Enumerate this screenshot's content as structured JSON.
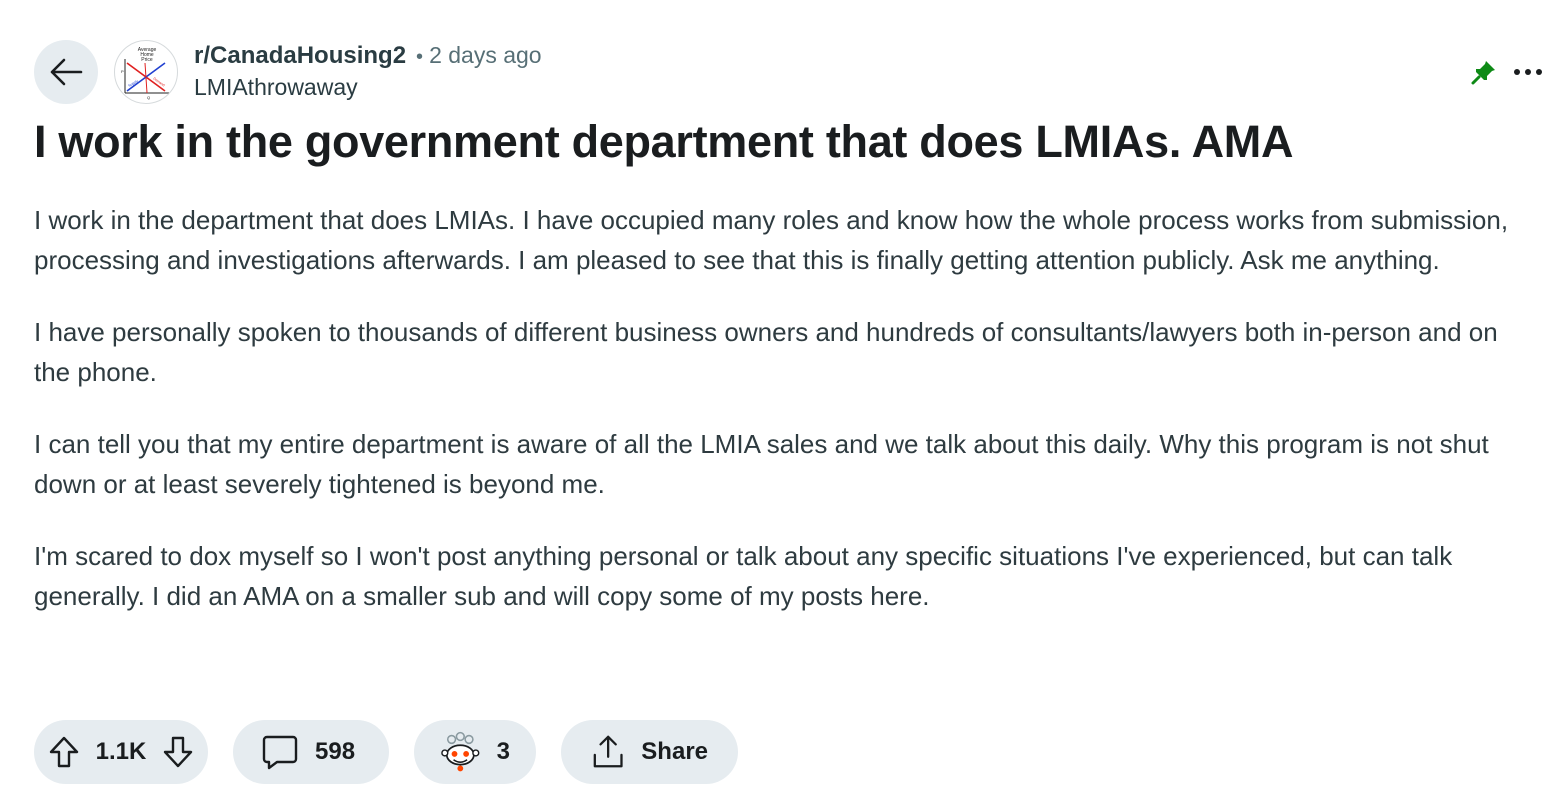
{
  "header": {
    "subreddit": "r/CanadaHousing2",
    "separator": "•",
    "time": "2 days ago",
    "author": "LMIAthrowaway",
    "avatar_labels": {
      "top": "Average",
      "top2": "Home",
      "top3": "Price",
      "p": "P",
      "q": "Q",
      "supply": "Supply",
      "demand": "Demand"
    }
  },
  "post": {
    "title": "I work in the government department that does LMIAs. AMA",
    "paragraphs": [
      "I work in the department that does LMIAs. I have occupied many roles and know how the whole process works from submission, processing and investigations afterwards. I am pleased to see that this is finally getting attention publicly. Ask me anything.",
      "I have personally spoken to thousands of different business owners and hundreds of consultants/lawyers both in-person and on the phone.",
      "I can tell you that my entire department is aware of all the LMIA sales and we talk about this daily. Why this program is not shut down or at least severely tightened is beyond me.",
      "I'm scared to dox myself so I won't post anything personal or talk about any specific situations I've experienced, but can talk generally. I did an AMA on a smaller sub and will copy some of my posts here."
    ]
  },
  "actions": {
    "votes": "1.1K",
    "comments": "598",
    "awards": "3",
    "share": "Share"
  },
  "icons": {
    "back": "back-arrow-icon",
    "pin": "pin-icon",
    "more": "more-icon",
    "upvote": "upvote-icon",
    "downvote": "downvote-icon",
    "comment": "comment-icon",
    "award": "award-icon",
    "share": "share-icon"
  },
  "colors": {
    "pill_bg": "#e6ecf0",
    "pin": "#0e8a16",
    "meta_text": "#576f76",
    "body_text": "#2e3b40"
  }
}
